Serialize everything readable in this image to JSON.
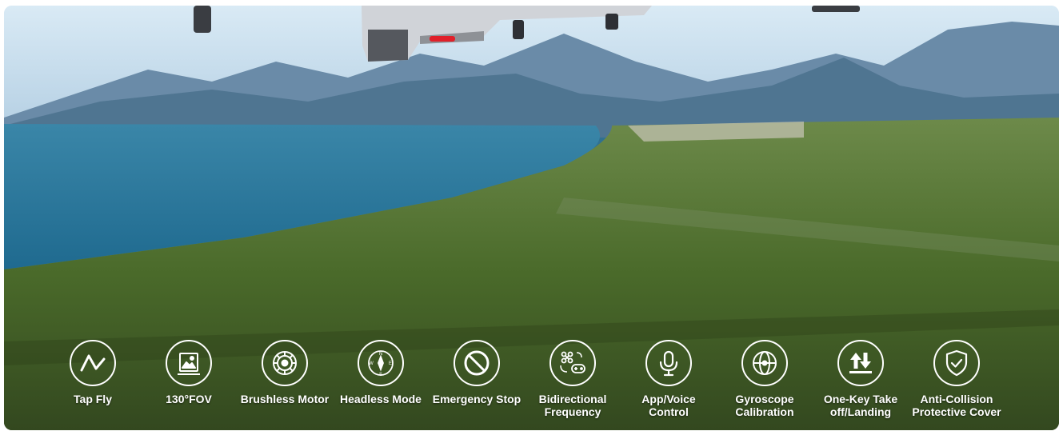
{
  "features": [
    {
      "icon": "tap-fly-icon",
      "label": "Tap Fly"
    },
    {
      "icon": "fov-icon",
      "label": "130°FOV"
    },
    {
      "icon": "brushless-motor-icon",
      "label": "Brushless Motor"
    },
    {
      "icon": "compass-icon",
      "label": "Headless Mode"
    },
    {
      "icon": "emergency-stop-icon",
      "label": "Emergency Stop"
    },
    {
      "icon": "drone-gamepad-icon",
      "label": "Bidirectional\nFrequency"
    },
    {
      "icon": "microphone-icon",
      "label": "App/Voice\nControl"
    },
    {
      "icon": "gyroscope-icon",
      "label": "Gyroscope\nCalibration"
    },
    {
      "icon": "takeoff-landing-icon",
      "label": "One-Key Take\noff/Landing"
    },
    {
      "icon": "shield-check-icon",
      "label": "Anti-Collision\nProtective Cover"
    }
  ],
  "colors": {
    "icon_stroke": "#ffffff",
    "label": "#ffffff",
    "drone_light": "#e0202a"
  }
}
